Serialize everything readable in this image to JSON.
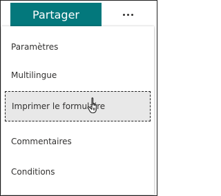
{
  "toolbar": {
    "share_label": "Partager",
    "more_label": "…"
  },
  "menu": {
    "items": [
      {
        "label": "Paramètres"
      },
      {
        "label": "Multilingue"
      },
      {
        "label": "Imprimer le formulaire",
        "state": "focused"
      },
      {
        "label": "Commentaires"
      },
      {
        "label": "Conditions"
      }
    ]
  },
  "colors": {
    "accent": "#03787c",
    "text": "#323130",
    "hover_bg": "#e8e8e8"
  },
  "icons": {
    "more": "more-horizontal-icon",
    "cursor": "hand-pointer-cursor-icon"
  }
}
